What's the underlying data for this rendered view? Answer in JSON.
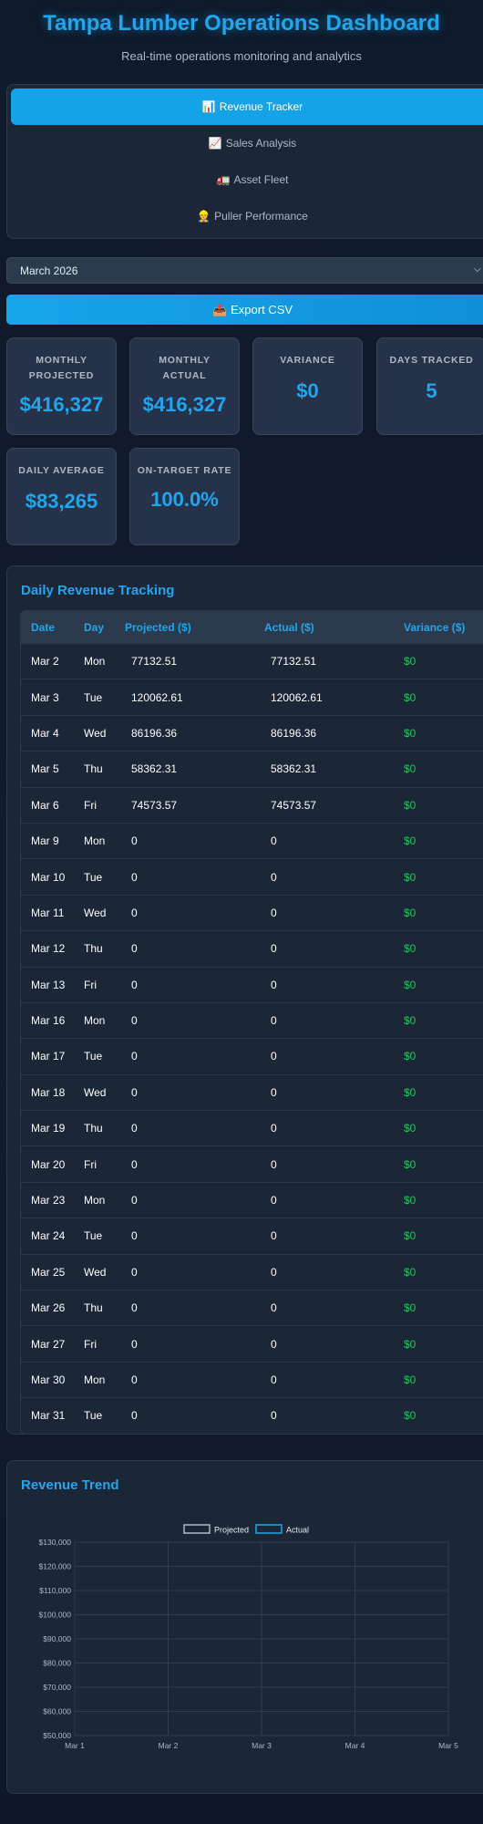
{
  "header": {
    "title": "Tampa Lumber Operations Dashboard",
    "subtitle": "Real-time operations monitoring and analytics"
  },
  "nav": [
    {
      "icon": "📊",
      "label": "Revenue Tracker",
      "active": true
    },
    {
      "icon": "📈",
      "label": "Sales Analysis",
      "active": false
    },
    {
      "icon": "🚛",
      "label": "Asset Fleet",
      "active": false
    },
    {
      "icon": "👷",
      "label": "Puller Performance",
      "active": false
    }
  ],
  "month_select": {
    "value": "March 2026"
  },
  "export": {
    "icon": "📤",
    "label": "Export CSV"
  },
  "stats": [
    {
      "label": "MONTHLY PROJECTED",
      "value": "$416,327"
    },
    {
      "label": "MONTHLY ACTUAL",
      "value": "$416,327"
    },
    {
      "label": "VARIANCE",
      "value": "$0"
    },
    {
      "label": "DAYS TRACKED",
      "value": "5"
    },
    {
      "label": "DAILY AVERAGE",
      "value": "$83,265"
    },
    {
      "label": "ON-TARGET RATE",
      "value": "100.0%"
    }
  ],
  "table": {
    "title": "Daily Revenue Tracking",
    "headers": [
      "Date",
      "Day",
      "Projected ($)",
      "Actual ($)",
      "Variance ($)"
    ],
    "rows": [
      [
        "Mar 2",
        "Mon",
        "77132.51",
        "77132.51",
        "$0"
      ],
      [
        "Mar 3",
        "Tue",
        "120062.61",
        "120062.61",
        "$0"
      ],
      [
        "Mar 4",
        "Wed",
        "86196.36",
        "86196.36",
        "$0"
      ],
      [
        "Mar 5",
        "Thu",
        "58362.31",
        "58362.31",
        "$0"
      ],
      [
        "Mar 6",
        "Fri",
        "74573.57",
        "74573.57",
        "$0"
      ],
      [
        "Mar 9",
        "Mon",
        "0",
        "0",
        "$0"
      ],
      [
        "Mar 10",
        "Tue",
        "0",
        "0",
        "$0"
      ],
      [
        "Mar 11",
        "Wed",
        "0",
        "0",
        "$0"
      ],
      [
        "Mar 12",
        "Thu",
        "0",
        "0",
        "$0"
      ],
      [
        "Mar 13",
        "Fri",
        "0",
        "0",
        "$0"
      ],
      [
        "Mar 16",
        "Mon",
        "0",
        "0",
        "$0"
      ],
      [
        "Mar 17",
        "Tue",
        "0",
        "0",
        "$0"
      ],
      [
        "Mar 18",
        "Wed",
        "0",
        "0",
        "$0"
      ],
      [
        "Mar 19",
        "Thu",
        "0",
        "0",
        "$0"
      ],
      [
        "Mar 20",
        "Fri",
        "0",
        "0",
        "$0"
      ],
      [
        "Mar 23",
        "Mon",
        "0",
        "0",
        "$0"
      ],
      [
        "Mar 24",
        "Tue",
        "0",
        "0",
        "$0"
      ],
      [
        "Mar 25",
        "Wed",
        "0",
        "0",
        "$0"
      ],
      [
        "Mar 26",
        "Thu",
        "0",
        "0",
        "$0"
      ],
      [
        "Mar 27",
        "Fri",
        "0",
        "0",
        "$0"
      ],
      [
        "Mar 30",
        "Mon",
        "0",
        "0",
        "$0"
      ],
      [
        "Mar 31",
        "Tue",
        "0",
        "0",
        "$0"
      ]
    ]
  },
  "colors": {
    "accent": "#1ea7ee",
    "positive": "#22c55e",
    "projected_line": "#aeb8c6",
    "actual_line": "#1ea7ee"
  },
  "chart_data": {
    "type": "line",
    "title": "Revenue Trend",
    "categories": [
      "Mar 1",
      "Mar 2",
      "Mar 3",
      "Mar 4",
      "Mar 5"
    ],
    "series": [
      {
        "name": "Projected",
        "values": [
          null,
          null,
          null,
          null,
          null
        ]
      },
      {
        "name": "Actual",
        "values": [
          null,
          null,
          null,
          null,
          null
        ]
      }
    ],
    "ylim": [
      50000,
      130000
    ],
    "yticks": [
      "$50,000",
      "$60,000",
      "$70,000",
      "$80,000",
      "$90,000",
      "$100,000",
      "$110,000",
      "$120,000",
      "$130,000"
    ],
    "legend": "top-center",
    "grid": true
  }
}
